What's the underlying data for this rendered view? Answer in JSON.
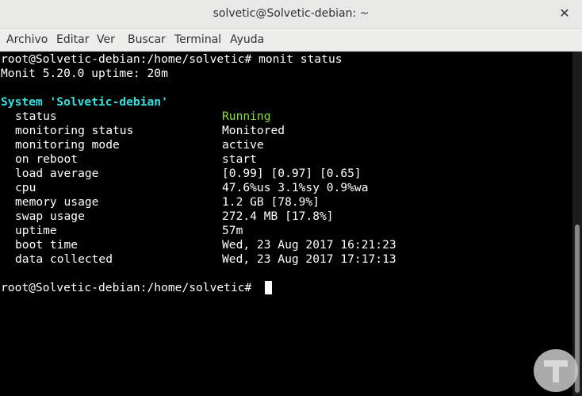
{
  "window": {
    "title": "solvetic@Solvetic-debian: ~",
    "close_glyph": "✕"
  },
  "menu": [
    "Archivo",
    "Editar",
    "Ver",
    "Buscar",
    "Terminal",
    "Ayuda"
  ],
  "terminal": {
    "prompt1": "root@Solvetic-debian:/home/solvetic# monit status",
    "version_line": "Monit 5.20.0 uptime: 20m",
    "system_header": "System 'Solvetic-debian'",
    "rows": [
      {
        "key": "status",
        "value": "Running"
      },
      {
        "key": "monitoring status",
        "value": "Monitored"
      },
      {
        "key": "monitoring mode",
        "value": "active"
      },
      {
        "key": "on reboot",
        "value": "start"
      },
      {
        "key": "load average",
        "value": "[0.99] [0.97] [0.65]"
      },
      {
        "key": "cpu",
        "value": "47.6%us 3.1%sy 0.9%wa"
      },
      {
        "key": "memory usage",
        "value": "1.2 GB [78.9%]"
      },
      {
        "key": "swap usage",
        "value": "272.4 MB [17.8%]"
      },
      {
        "key": "uptime",
        "value": "57m"
      },
      {
        "key": "boot time",
        "value": "Wed, 23 Aug 2017 16:21:23"
      },
      {
        "key": "data collected",
        "value": "Wed, 23 Aug 2017 17:17:13"
      }
    ],
    "prompt2": "root@Solvetic-debian:/home/solvetic# "
  },
  "colors": {
    "header": "#34e2e2",
    "running": "#8ae234",
    "text": "#ffffff",
    "bg": "#000000"
  }
}
